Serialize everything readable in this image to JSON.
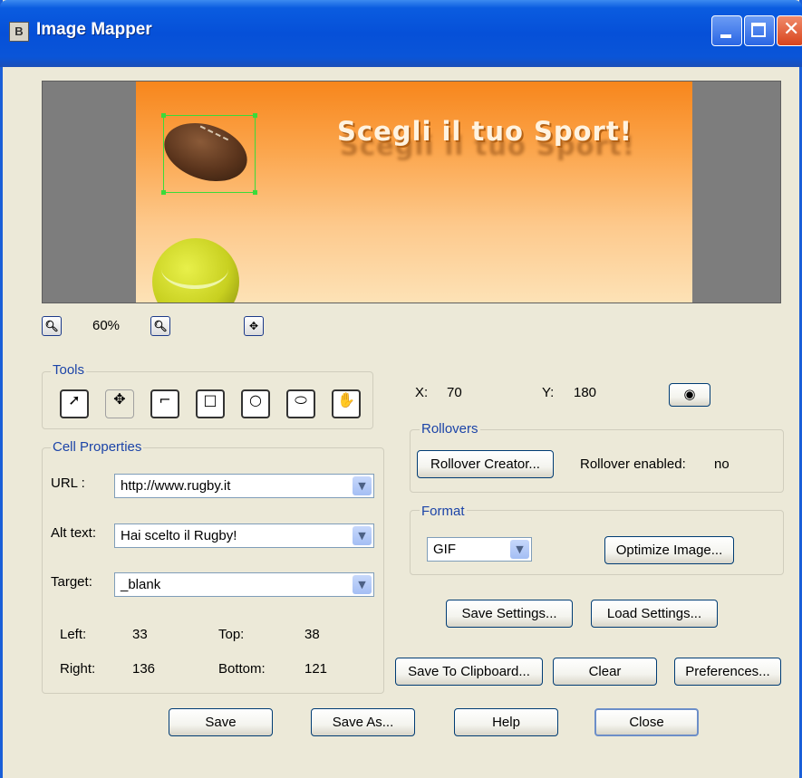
{
  "window": {
    "title": "Image Mapper",
    "app_icon": "B",
    "icons": [
      "minimize-icon",
      "maximize-icon",
      "close-icon"
    ]
  },
  "preview": {
    "banner_text": "Scegli il tuo Sport!"
  },
  "zoom": {
    "zoom_out_icon": "zoom-out-icon",
    "zoom_in_icon": "zoom-in-icon",
    "pan_icon": "pan-move-icon",
    "level": "60%"
  },
  "tools": {
    "label": "Tools",
    "items": [
      "pointer-tool-icon",
      "move-tool-icon",
      "polygon-tool-icon",
      "rectangle-tool-icon",
      "circle-tool-icon",
      "eraser-tool-icon",
      "hand-tool-icon"
    ]
  },
  "cell_properties": {
    "label": "Cell Properties",
    "url_label": "URL :",
    "url_value": "http://www.rugby.it",
    "alt_label": "Alt text:",
    "alt_value": "Hai scelto il Rugby!",
    "target_label": "Target:",
    "target_value": "_blank",
    "left_label": "Left:",
    "left_value": "33",
    "top_label": "Top:",
    "top_value": "38",
    "right_label": "Right:",
    "right_value": "136",
    "bottom_label": "Bottom:",
    "bottom_value": "121"
  },
  "coords": {
    "x_label": "X:",
    "x_value": "70",
    "y_label": "Y:",
    "y_value": "180",
    "eye_icon": "eye-icon"
  },
  "rollovers": {
    "label": "Rollovers",
    "creator_button": "Rollover Creator...",
    "enabled_label": "Rollover enabled:",
    "enabled_value": "no"
  },
  "format": {
    "label": "Format",
    "value": "GIF",
    "optimize_button": "Optimize Image..."
  },
  "buttons": {
    "save_settings": "Save Settings...",
    "load_settings": "Load Settings...",
    "save_clipboard": "Save To Clipboard...",
    "clear": "Clear",
    "preferences": "Preferences...",
    "save": "Save",
    "save_as": "Save As...",
    "help": "Help",
    "close": "Close"
  }
}
